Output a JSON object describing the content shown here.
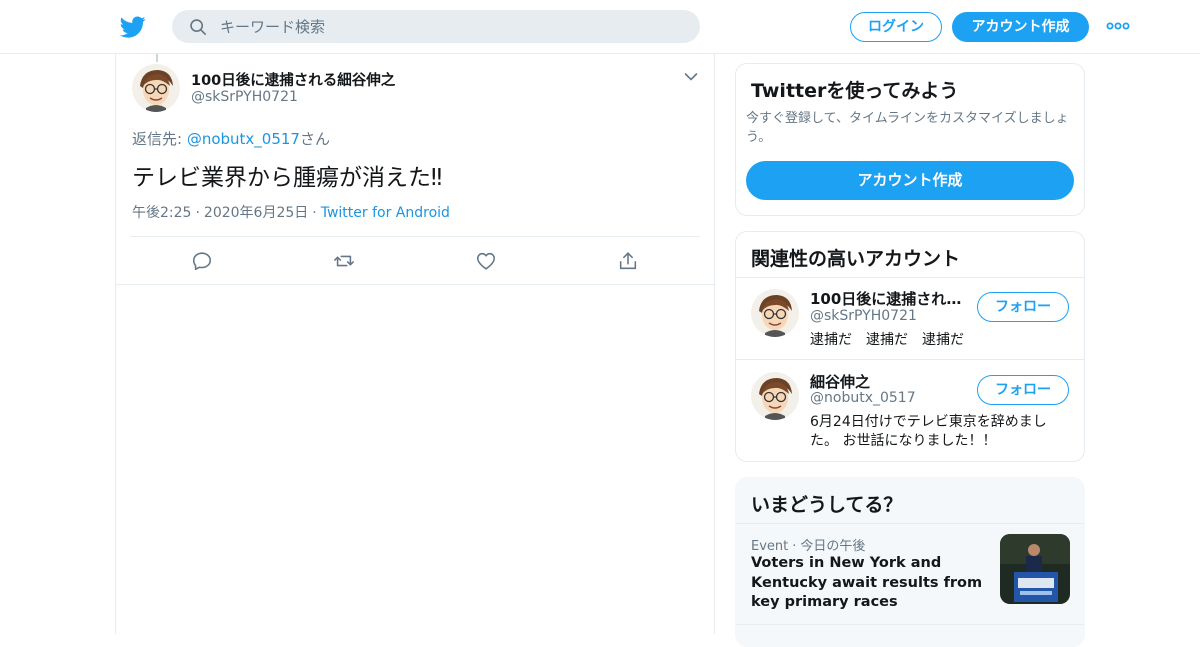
{
  "header": {
    "search_placeholder": "キーワード検索",
    "login_label": "ログイン",
    "signup_label": "アカウント作成"
  },
  "tweet": {
    "display_name": "100日後に逮捕される細谷伸之",
    "handle": "@skSrPYH0721",
    "reply_prefix": "返信先: ",
    "reply_mention": "@nobutx_0517",
    "reply_suffix": "さん",
    "text": "テレビ業界から腫瘍が消えた‼",
    "time": "午後2:25",
    "date": "2020年6月25日",
    "source": "Twitter for Android",
    "separator": "·"
  },
  "signup_card": {
    "title": "Twitterを使ってみよう",
    "description": "今すぐ登録して、タイムラインをカスタマイズしましょう。",
    "button": "アカウント作成"
  },
  "related": {
    "title": "関連性の高いアカウント",
    "accounts": [
      {
        "name": "100日後に逮捕される細谷伸之",
        "handle": "@skSrPYH0721",
        "bio": "逮捕だ　逮捕だ　逮捕だ",
        "follow": "フォロー"
      },
      {
        "name": "細谷伸之",
        "handle": "@nobutx_0517",
        "bio": "6月24日付けでテレビ東京を辞めました。 お世話になりました！！",
        "follow": "フォロー"
      }
    ]
  },
  "trends": {
    "title": "いまどうしてる？",
    "items": [
      {
        "category": "Event",
        "time": "今日の午後",
        "title": "Voters in New York and Kentucky await results from key primary races"
      }
    ]
  },
  "colors": {
    "brand": "#1da1f2",
    "link": "#1b95e0",
    "secondary_text": "#657786",
    "border": "#e6ecf0"
  },
  "icons": [
    "twitter-bird-icon",
    "search-icon",
    "more-icon",
    "chevron-down-icon",
    "reply-icon",
    "retweet-icon",
    "like-icon",
    "share-icon"
  ]
}
